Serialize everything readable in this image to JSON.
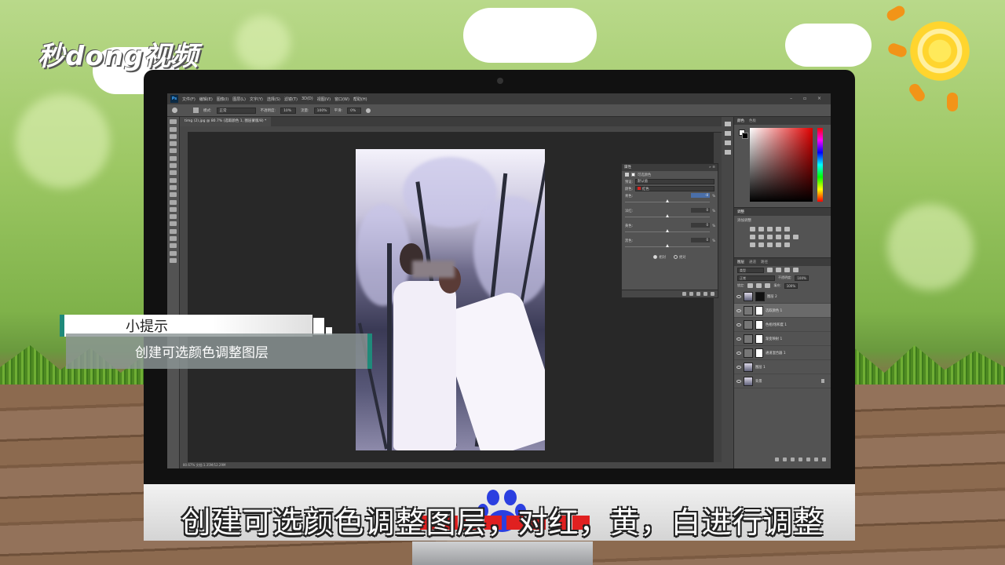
{
  "brand": {
    "logo_text": "秒dong视频"
  },
  "photoshop": {
    "menu": [
      "文件(F)",
      "编辑(E)",
      "图像(I)",
      "图层(L)",
      "文字(Y)",
      "选择(S)",
      "滤镜(T)",
      "3D(D)",
      "视图(V)",
      "窗口(W)",
      "帮助(H)"
    ],
    "window_controls": "– ▫ ×",
    "options": {
      "mode_label": "模式:",
      "mode_value": "正常",
      "opacity_label": "不透明度:",
      "opacity_value": "10%",
      "flow_label": "流量:",
      "flow_value": "100%",
      "smooth_label": "平滑:",
      "smooth_value": "0%"
    },
    "doc_tab": "timg (2).jpg @ 80.7% (选取颜色 1, 图层蒙版/8) *",
    "status": "80.67%      文档:1.35M/12.29M",
    "properties": {
      "title": "属性",
      "subtitle": "可选颜色",
      "preset_label": "预设:",
      "preset_value": "默认值",
      "colors_label": "颜色:",
      "colors_value": "红色",
      "sliders": [
        {
          "label": "青色:",
          "value": "-8",
          "pct": "%"
        },
        {
          "label": "洋红:",
          "value": "0",
          "pct": "%"
        },
        {
          "label": "黄色:",
          "value": "0",
          "pct": "%"
        },
        {
          "label": "黑色:",
          "value": "0",
          "pct": "%"
        }
      ],
      "radio_relative": "相对",
      "radio_absolute": "绝对"
    },
    "color_panel": {
      "tab_active": "颜色",
      "tab_other": "色板"
    },
    "adjust_panel": {
      "title": "调整",
      "add_label": "添加调整"
    },
    "layers_panel": {
      "tabs": [
        "图层",
        "通道",
        "路径"
      ],
      "kind": "类型",
      "blend": "正常",
      "opacity_label": "不透明度:",
      "opacity_value": "100%",
      "lock_label": "锁定:",
      "fill_label": "填充:",
      "fill_value": "100%",
      "layers": [
        {
          "name": "图层 2",
          "selected": false
        },
        {
          "name": "选取颜色 1",
          "selected": true
        },
        {
          "name": "色相/饱和度 1",
          "selected": false
        },
        {
          "name": "渐变映射 1",
          "selected": false
        },
        {
          "name": "通道混合器 1",
          "selected": false
        },
        {
          "name": "图层 1",
          "selected": false
        },
        {
          "name": "背景",
          "selected": false
        }
      ]
    }
  },
  "tip": {
    "heading": "小提示",
    "body": "创建可选颜色调整图层"
  },
  "subtitle": "创建可选颜色调整图层，对红，黄，白进行调整",
  "colors": {
    "accent_teal": "#1f8a7a",
    "ps_dark": "#535353",
    "swatch_red": "#d5231f"
  }
}
